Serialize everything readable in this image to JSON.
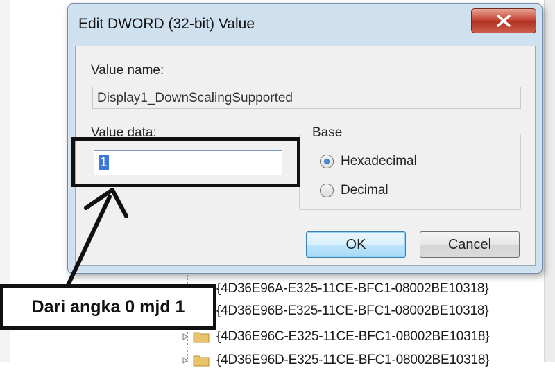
{
  "dialog": {
    "title": "Edit DWORD (32-bit) Value",
    "value_name_label": "Value name:",
    "value_name": "Display1_DownScalingSupported",
    "value_data_label": "Value data:",
    "value_data": "1",
    "base_label": "Base",
    "radio_hex": "Hexadecimal",
    "radio_dec": "Decimal",
    "selected_base": "Hexadecimal",
    "ok_label": "OK",
    "cancel_label": "Cancel"
  },
  "background_keys": [
    "{4D36E96A-E325-11CE-BFC1-08002BE10318}",
    "{4D36E96B-E325-11CE-BFC1-08002BE10318}",
    "{4D36E96C-E325-11CE-BFC1-08002BE10318}",
    "{4D36E96D-E325-11CE-BFC1-08002BE10318}"
  ],
  "annotation": {
    "caption": "Dari angka 0 mjd 1"
  }
}
